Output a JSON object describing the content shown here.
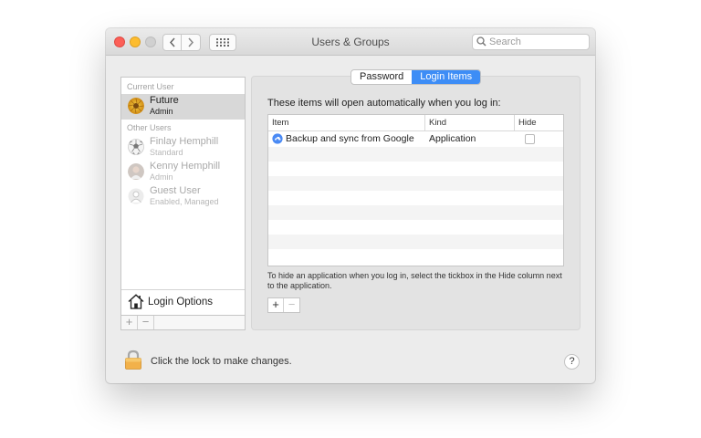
{
  "window": {
    "title": "Users & Groups"
  },
  "search": {
    "placeholder": "Search"
  },
  "sidebar": {
    "current_label": "Current User",
    "current_user": {
      "name": "Future",
      "role": "Admin"
    },
    "other_label": "Other Users",
    "others": [
      {
        "name": "Finlay Hemphill",
        "role": "Standard",
        "avatar": "soccer-ball-icon"
      },
      {
        "name": "Kenny Hemphill",
        "role": "Admin",
        "avatar": "person-photo"
      },
      {
        "name": "Guest User",
        "role": "Enabled, Managed",
        "avatar": "guest-icon"
      }
    ],
    "login_options": "Login Options",
    "add": "+",
    "remove": "−"
  },
  "tabs": [
    {
      "label": "Password",
      "active": false
    },
    {
      "label": "Login Items",
      "active": true
    }
  ],
  "main": {
    "intro": "These items will open automatically when you log in:",
    "columns": [
      "Item",
      "Kind",
      "Hide"
    ],
    "rows": [
      {
        "item": "Backup and sync from Google",
        "kind": "Application",
        "hide": false
      }
    ],
    "hint": "To hide an application when you log in, select the tickbox in the Hide column next to the application.",
    "add": "+",
    "remove": "−"
  },
  "footer": {
    "lock_text": "Click the lock to make changes.",
    "help": "?"
  },
  "colors": {
    "accent": "#3d8df6",
    "close": "#fc5f57",
    "minimize": "#fdbc2e",
    "zoom": "#d0d0d0"
  }
}
